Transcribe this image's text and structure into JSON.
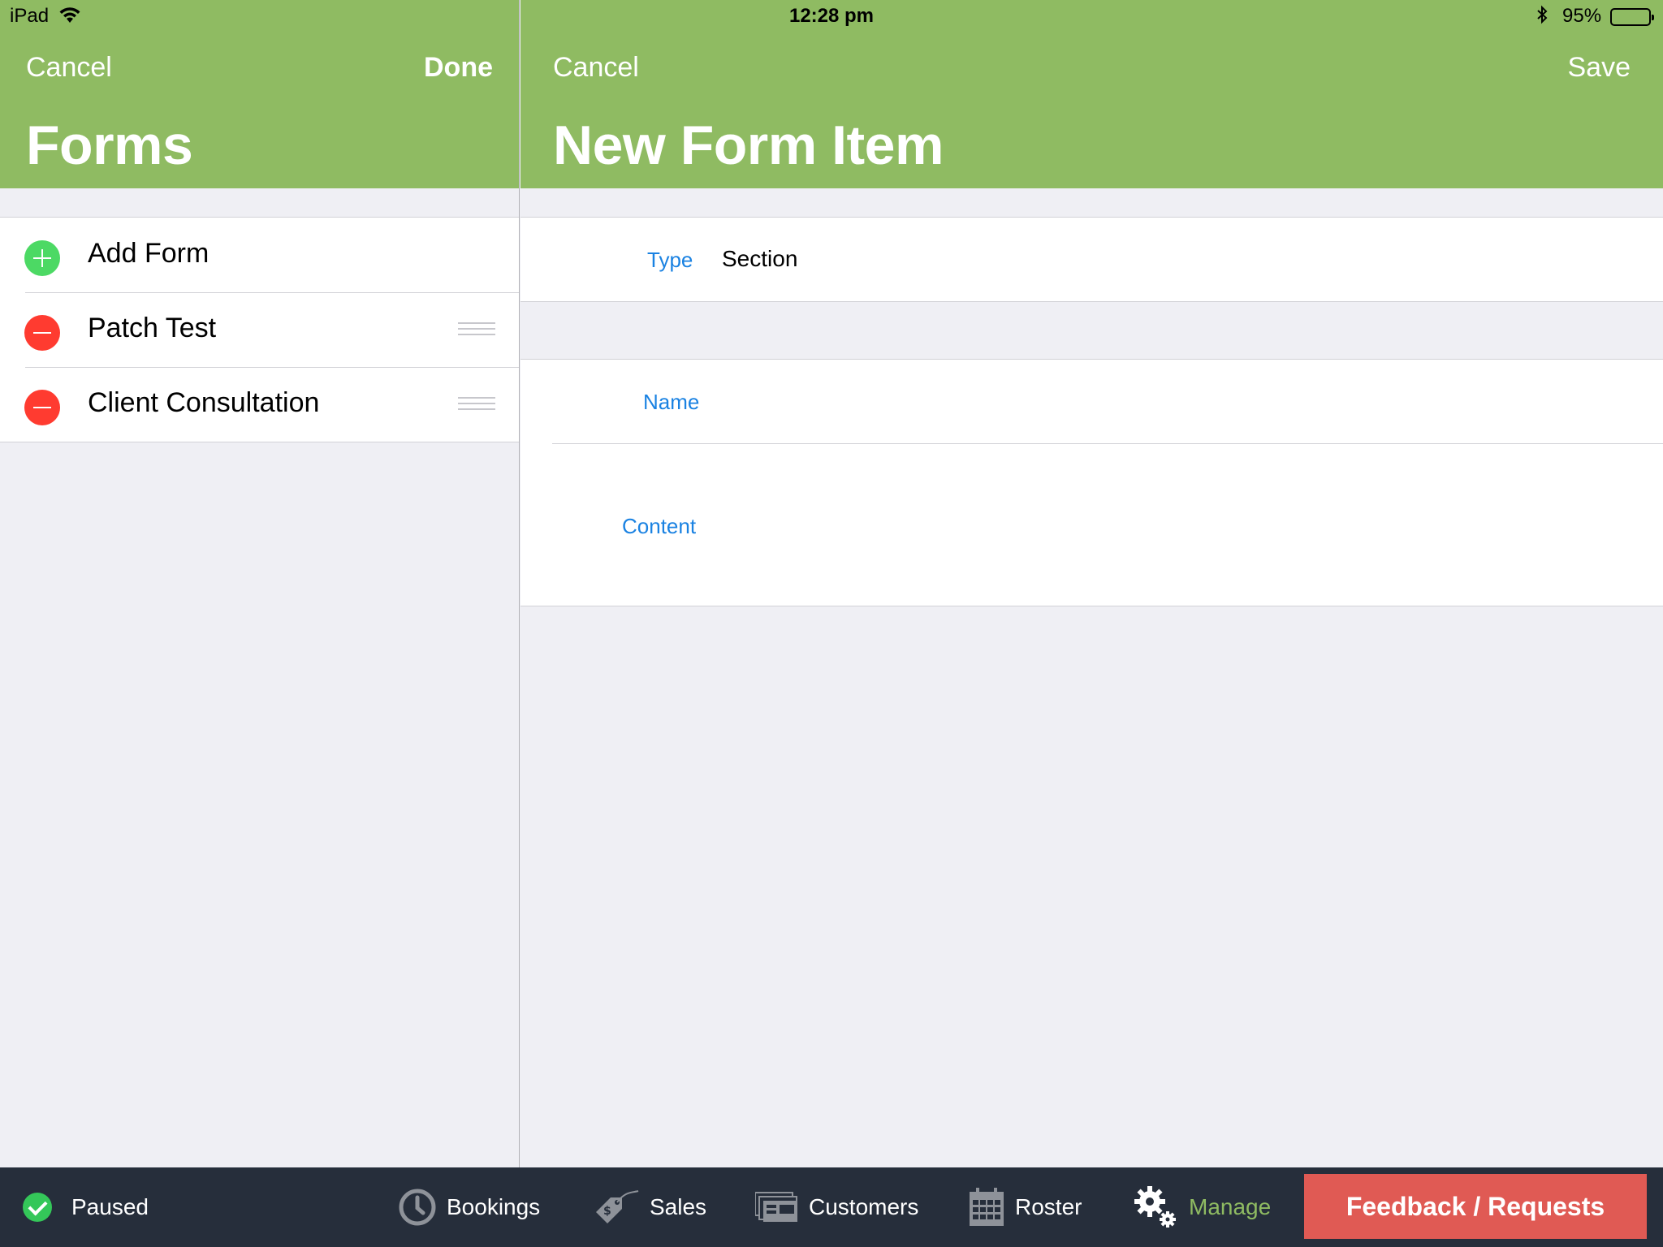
{
  "status_bar": {
    "device": "iPad",
    "time": "12:28 pm",
    "battery": "95%"
  },
  "left": {
    "cancel_label": "Cancel",
    "done_label": "Done",
    "title": "Forms",
    "items": [
      {
        "label": "Add Form",
        "action": "add"
      },
      {
        "label": "Patch Test",
        "action": "remove"
      },
      {
        "label": "Client Consultation",
        "action": "remove"
      }
    ]
  },
  "right": {
    "cancel_label": "Cancel",
    "save_label": "Save",
    "title": "New Form Item",
    "type_label": "Type",
    "type_value": "Section",
    "name_label": "Name",
    "name_value": "",
    "content_label": "Content",
    "content_value": ""
  },
  "tabbar": {
    "paused_label": "Paused",
    "tabs": [
      {
        "label": "Bookings",
        "icon": "clock-icon"
      },
      {
        "label": "Sales",
        "icon": "price-tag-icon"
      },
      {
        "label": "Customers",
        "icon": "customers-icon"
      },
      {
        "label": "Roster",
        "icon": "calendar-icon"
      },
      {
        "label": "Manage",
        "icon": "gear-icon",
        "active": true
      }
    ],
    "feedback_label": "Feedback / Requests"
  },
  "colors": {
    "navbar_green": "#8fbb62",
    "tabbar_dark": "#262e3b",
    "field_label_blue": "#1a82e2",
    "add_green": "#4cd964",
    "remove_red": "#ff3b30",
    "feedback_red": "#e05a54"
  }
}
